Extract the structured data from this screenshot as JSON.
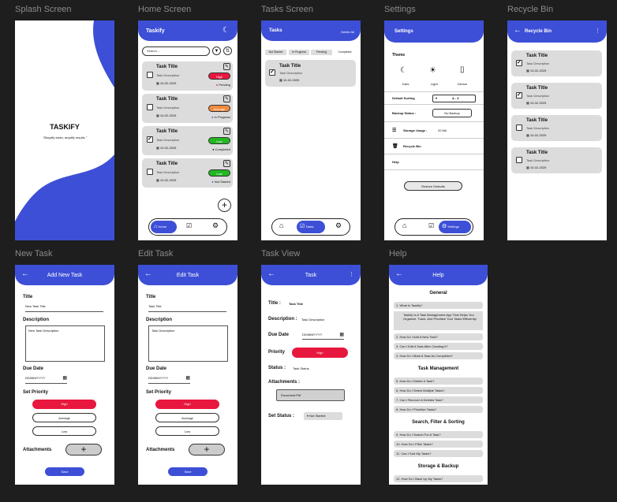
{
  "labels": {
    "splash": "Splash Screen",
    "home": "Home Screen",
    "tasks": "Tasks Screen",
    "settings": "Settings",
    "recycle": "Recycle Bin",
    "newtask": "New Task",
    "edittask": "Edit Task",
    "taskview": "Task View",
    "help": "Help"
  },
  "splash": {
    "title": "TASKIFY",
    "tagline": "\"Simplify tasks, amplify results.\""
  },
  "home": {
    "title": "Taskify",
    "search_placeholder": "Search....",
    "tasks": [
      {
        "title": "Task Title",
        "desc": "Task Description",
        "date": "10-02-2025",
        "priority": "High",
        "status": "Pending",
        "checked": false
      },
      {
        "title": "Task Title",
        "desc": "Task Description",
        "date": "10-02-2025",
        "priority": "Average",
        "status": "In Progress",
        "checked": false
      },
      {
        "title": "Task Title",
        "desc": "Task Description",
        "date": "10-02-2025",
        "priority": "Low",
        "status": "Completed",
        "checked": true
      },
      {
        "title": "Task Title",
        "desc": "Task Description",
        "date": "10-02-2025",
        "priority": "Low",
        "status": "Not Started",
        "checked": false
      }
    ],
    "nav_home": "Home"
  },
  "tasks": {
    "title": "Tasks",
    "delete_all": "Delete All",
    "filters": [
      "Not Started",
      "In Progress",
      "Pending",
      "Completed"
    ],
    "task": {
      "title": "Task Title",
      "desc": "Task Description",
      "date": "10-02-2025"
    },
    "nav_tasks": "Tasks"
  },
  "settings": {
    "title": "Settings",
    "theme": "Theme",
    "dark": "Dark",
    "light": "Light",
    "device": "Device",
    "default_sorting": "Default Sorting",
    "sort_value": "A - Z",
    "backup_status": "Backup Status :",
    "backup_value": "No Backup",
    "storage": "Storage Usage :",
    "storage_value": "20 Mb",
    "recycle": "Recycle Bin",
    "help": "Help",
    "restore": "Restore Defaults",
    "nav_settings": "Settings"
  },
  "recycle": {
    "title": "Recycle Bin",
    "tasks": [
      {
        "title": "Task Title",
        "desc": "Task Description",
        "date": "10-02-2025",
        "checked": true
      },
      {
        "title": "Task Title",
        "desc": "Task Description",
        "date": "10-02-2025",
        "checked": true
      },
      {
        "title": "Task Title",
        "desc": "Task Description",
        "date": "10-02-2025",
        "checked": false
      },
      {
        "title": "Task Title",
        "desc": "Task Description",
        "date": "10-02-2025",
        "checked": false
      }
    ]
  },
  "newtask": {
    "header": "Add New Task",
    "title_label": "Title",
    "title_value": "New Task Title",
    "desc_label": "Description",
    "desc_value": "New Task Description",
    "due_label": "Due Date",
    "due_value": "DD/MM/YYYY",
    "priority_label": "Set Priority",
    "high": "High",
    "average": "Average",
    "low": "Low",
    "attach": "Attachments",
    "save": "Save"
  },
  "edittask": {
    "header": "Edit Task",
    "title_label": "Title",
    "title_value": "Task Title",
    "desc_label": "Description",
    "desc_value": "Task Description",
    "due_label": "Due Date",
    "due_value": "DD/MM/YYYY",
    "priority_label": "Set Priority",
    "high": "High",
    "average": "Average",
    "low": "Low",
    "attach": "Attachments",
    "save": "Save"
  },
  "taskview": {
    "header": "Task",
    "title_label": "Title :",
    "title_value": "Task Title",
    "desc_label": "Description :",
    "desc_value": "Task Description",
    "due_label": "Due Date",
    "due_value": "DD/MM/YYYY",
    "priority_label": "Priority",
    "priority_value": "High",
    "status_label": "Status :",
    "status_value": "Task Status",
    "attach_label": "Attachments :",
    "attach_value": "Document.Pdf",
    "setstatus_label": "Set Status :",
    "setstatus_value": "Not Started"
  },
  "help": {
    "header": "Help",
    "sections": [
      {
        "name": "General",
        "items": [
          "1. What Is Taskify?",
          "Taskify Is A Task Management App That Helps You Organize, Track, And Prioritize Your Tasks Efficiently.",
          "2. How Do I Add A New Task?",
          "3. Can I Edit A Task After Creating It?",
          "4. How Do I Mark A Task As Completed?"
        ]
      },
      {
        "name": "Task Management",
        "items": [
          "5. How Do I Delete A Task?",
          "6. How Do I Select Multiple Tasks?",
          "7. Can I Recover A Deleted Task?",
          "8. How Do I Prioritize Tasks?"
        ]
      },
      {
        "name": "Search, Filter & Sorting",
        "items": [
          "9. How Do I Search For A Task?",
          "10. How Do I Filter Tasks?",
          "11. Can I Sort My Tasks?"
        ]
      },
      {
        "name": "Storage & Backup",
        "items": [
          "12. How Do I Back Up My Tasks?"
        ]
      }
    ]
  },
  "colors": {
    "accent": "#3d4fd6",
    "high": "#e8173e",
    "average": "#f08a3e",
    "low": "#22b822",
    "pending": "#e8173e",
    "progress": "#3d4fd6"
  }
}
